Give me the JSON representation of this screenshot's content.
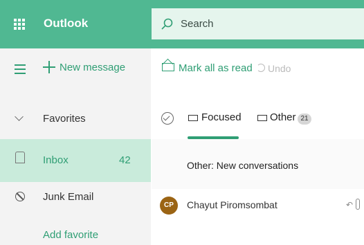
{
  "header": {
    "app_title": "Outlook",
    "search_placeholder": "Search"
  },
  "nav": {
    "new_message": "New message",
    "favorites": "Favorites",
    "inbox": {
      "label": "Inbox",
      "count": "42"
    },
    "junk": "Junk Email",
    "add_favorite": "Add favorite"
  },
  "toolbar": {
    "mark_all_read": "Mark all as read",
    "undo": "Undo"
  },
  "pivots": {
    "focused": "Focused",
    "other": "Other",
    "other_badge": "21"
  },
  "list": {
    "subheader": "Other: New conversations",
    "items": [
      {
        "initials": "CP",
        "sender": "Chayut Piromsombat"
      }
    ]
  },
  "colors": {
    "brand": "#50b892",
    "accent": "#2f9e74",
    "selected": "#c9ebdb",
    "avatar": "#9b6414"
  }
}
